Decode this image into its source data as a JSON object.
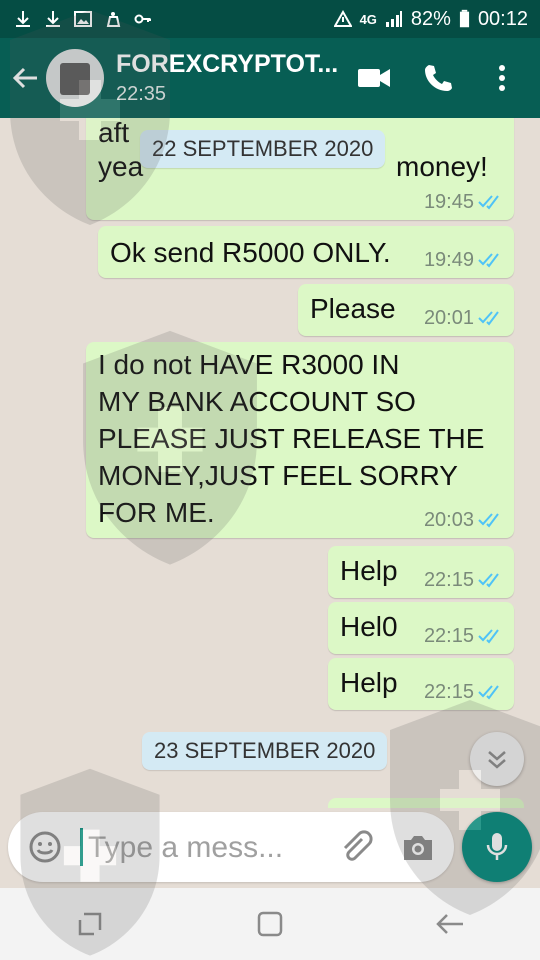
{
  "status_bar": {
    "battery": "82%",
    "time": "00:12",
    "network": "4G"
  },
  "header": {
    "contact_name": "FOREXCRYPTOT...",
    "last_seen": "22:35"
  },
  "messages": [
    {
      "text": "after XXXXX XXX XXXX 19 years ... money!",
      "partial_top": "aft",
      "partial_bottom_left": "yea",
      "partial_bottom_right": "money!",
      "time": "19:45"
    },
    {
      "text": "Ok send R5000 ONLY.",
      "time": "19:49"
    },
    {
      "text": "Please",
      "time": "20:01"
    },
    {
      "lines": [
        "I do not HAVE R3000 IN",
        "MY BANK ACCOUNT SO",
        "PLEASE JUST RELEASE THE",
        "MONEY,JUST FEEL SORRY",
        "FOR ME."
      ],
      "time": "20:03"
    },
    {
      "text": "Help",
      "time": "22:15"
    },
    {
      "text": "Hel0",
      "time": "22:15"
    },
    {
      "text": "Help",
      "time": "22:15"
    }
  ],
  "date_chips": {
    "first": "22 SEPTEMBER 2020",
    "second": "23 SEPTEMBER 2020"
  },
  "input": {
    "placeholder": "Type a mess..."
  },
  "colors": {
    "header": "#075e54",
    "status_bar": "#054d44",
    "outgoing_bubble": "#dcf8c6",
    "chat_bg": "#e5ddd5",
    "read_tick": "#4fc3f7",
    "mic_button": "#00897b"
  },
  "icons": [
    "back-arrow-icon",
    "video-call-icon",
    "phone-icon",
    "more-options-icon",
    "emoji-icon",
    "attach-icon",
    "camera-icon",
    "mic-icon",
    "chevron-down-icon",
    "double-tick-icon"
  ]
}
